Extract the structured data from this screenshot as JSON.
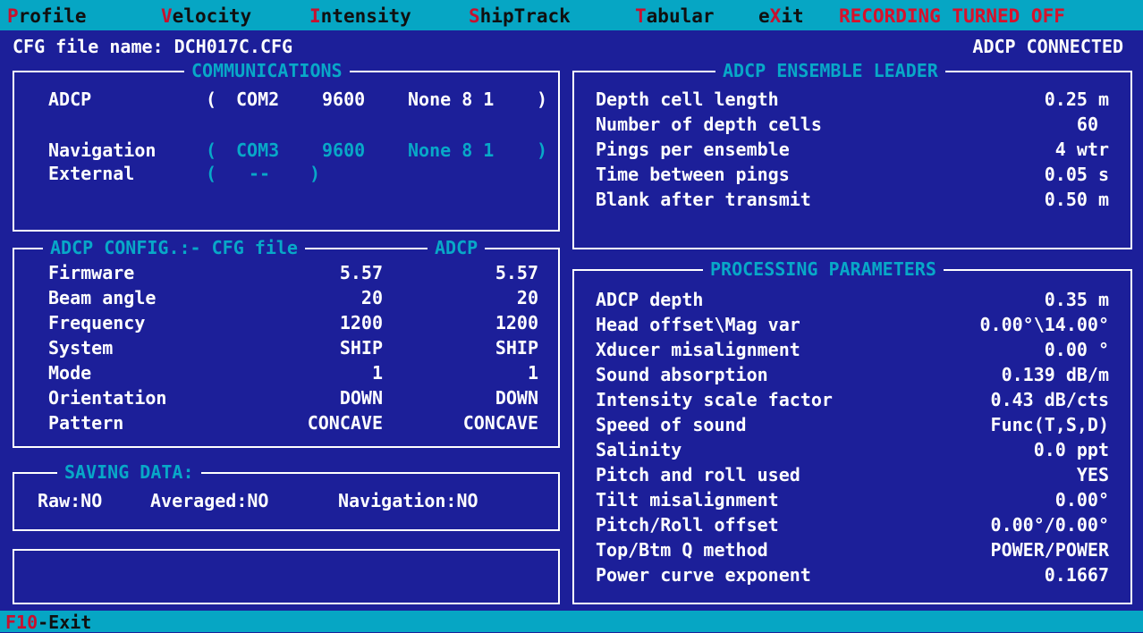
{
  "menu": {
    "items": [
      {
        "hotkey": "P",
        "rest": "rofile"
      },
      {
        "hotkey": "V",
        "rest": "elocity"
      },
      {
        "hotkey": "I",
        "rest": "ntensity"
      },
      {
        "hotkey": "S",
        "rest": "hipTrack"
      },
      {
        "hotkey": "T",
        "rest": "abular"
      },
      {
        "pre": "e",
        "hotkey": "X",
        "rest": "it"
      }
    ],
    "recording_status": "RECORDING TURNED OFF"
  },
  "header": {
    "cfg_label": "CFG file name:",
    "cfg_value": "DCH017C.CFG",
    "connection_status": "ADCP CONNECTED"
  },
  "communications": {
    "title": "COMMUNICATIONS",
    "adcp": {
      "label": "ADCP",
      "open": "(",
      "port": "COM2",
      "baud": "9600",
      "params": "None 8 1",
      "close": ")"
    },
    "navigation": {
      "label": "Navigation",
      "open": "(",
      "port": "COM3",
      "baud": "9600",
      "params": "None 8 1",
      "close": ")"
    },
    "external": {
      "label": "External",
      "open": "(",
      "port": "--",
      "close": ")"
    }
  },
  "adcp_config": {
    "title_left": "ADCP CONFIG.:- CFG file",
    "title_right": "ADCP",
    "rows": [
      {
        "label": "Firmware",
        "cfg": "5.57",
        "adcp": "5.57"
      },
      {
        "label": "Beam angle",
        "cfg": "20",
        "adcp": "20"
      },
      {
        "label": "Frequency",
        "cfg": "1200",
        "adcp": "1200"
      },
      {
        "label": "System",
        "cfg": "SHIP",
        "adcp": "SHIP"
      },
      {
        "label": "Mode",
        "cfg": "1",
        "adcp": "1"
      },
      {
        "label": "Orientation",
        "cfg": "DOWN",
        "adcp": "DOWN"
      },
      {
        "label": "Pattern",
        "cfg": "CONCAVE",
        "adcp": "CONCAVE"
      }
    ]
  },
  "saving_data": {
    "title": "SAVING DATA:",
    "raw": "Raw:NO",
    "averaged": "Averaged:NO",
    "navigation": "Navigation:NO"
  },
  "ensemble_leader": {
    "title": "ADCP ENSEMBLE LEADER",
    "rows": [
      {
        "label": "Depth cell length",
        "value": "0.25 m"
      },
      {
        "label": "Number of depth cells",
        "value": "60"
      },
      {
        "label": "Pings per ensemble",
        "value": "4 wtr"
      },
      {
        "label": "Time between pings",
        "value": "0.05 s"
      },
      {
        "label": "Blank after transmit",
        "value": "0.50 m"
      }
    ]
  },
  "processing": {
    "title": "PROCESSING PARAMETERS",
    "rows": [
      {
        "label": "ADCP depth",
        "value": "0.35 m"
      },
      {
        "label": "Head offset\\Mag var",
        "value": "0.00°\\14.00°"
      },
      {
        "label": "Xducer misalignment",
        "value": "0.00 °"
      },
      {
        "label": "Sound absorption",
        "value": "0.139 dB/m"
      },
      {
        "label": "Intensity scale factor",
        "value": "0.43 dB/cts"
      },
      {
        "label": "Speed of sound",
        "value": "Func(T,S,D)"
      },
      {
        "label": "Salinity",
        "value": "0.0 ppt"
      },
      {
        "label": "Pitch and roll used",
        "value": "YES"
      },
      {
        "label": "Tilt misalignment",
        "value": "0.00°"
      },
      {
        "label": "Pitch/Roll offset",
        "value": "0.00°/0.00°"
      },
      {
        "label": "Top/Btm Q method",
        "value": "POWER/POWER"
      },
      {
        "label": "Power curve exponent",
        "value": "0.1667"
      }
    ]
  },
  "status": {
    "key": "F10",
    "label": "-Exit"
  },
  "colors": {
    "background": "#1c1f99",
    "bar": "#06a6c4",
    "cyan": "#08a8c8",
    "hotkey": "#c8102e"
  }
}
